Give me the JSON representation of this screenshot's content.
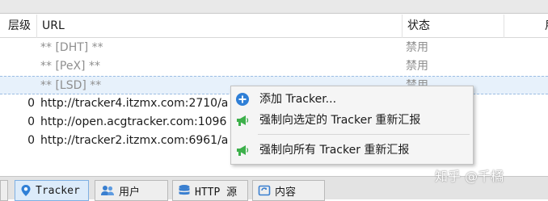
{
  "table": {
    "columns": {
      "level": "层级",
      "url": "URL",
      "status": "状态",
      "extra": "用"
    },
    "rows": [
      {
        "level": "",
        "url": "** [DHT] **",
        "status": "禁用"
      },
      {
        "level": "",
        "url": "** [PeX] **",
        "status": "禁用"
      },
      {
        "level": "",
        "url": "** [LSD] **",
        "status": "禁用"
      },
      {
        "level": "0",
        "url": "http://tracker4.itzmx.com:2710/a",
        "status": ""
      },
      {
        "level": "0",
        "url": "http://open.acgtracker.com:1096",
        "status": ""
      },
      {
        "level": "0",
        "url": "http://tracker2.itzmx.com:6961/a",
        "status": ""
      }
    ]
  },
  "context_menu": {
    "add_tracker": "添加 Tracker...",
    "force_reannounce_selected": "强制向选定的 Tracker 重新汇报",
    "force_reannounce_all": "强制向所有 Tracker 重新汇报"
  },
  "tabs": {
    "tracker": "Tracker",
    "peers": "用户",
    "http_sources": "HTTP 源",
    "content": "内容"
  },
  "watermark": "知乎 @千橘",
  "colors": {
    "add_icon": "#2f7fd6",
    "speaker_icon": "#3db04b",
    "selected_row": "#e7f1fb"
  }
}
